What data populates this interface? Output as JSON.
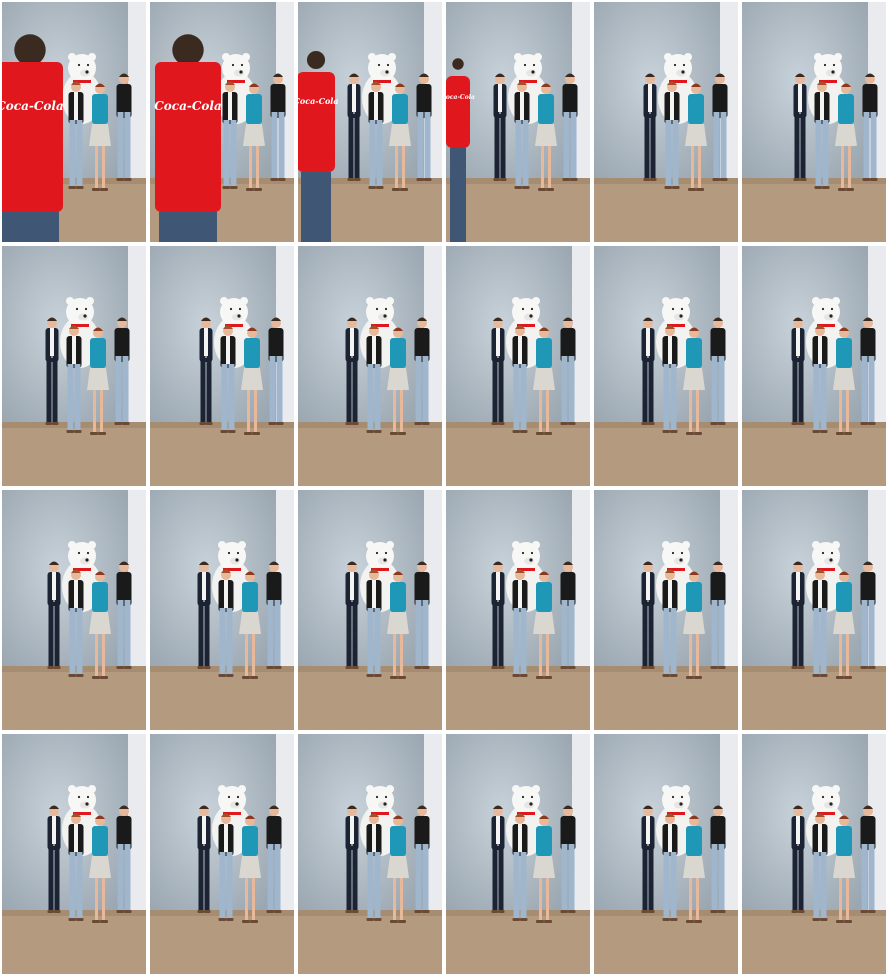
{
  "sheet": {
    "columns": 6,
    "rows": 4
  },
  "colors": {
    "backdrop": "#9aa6b0",
    "backdrop_light": "#c8d2da",
    "wall": "#e9ebee",
    "floor": "#b49a7e",
    "floor_dark": "#9d8468",
    "navy": "#1c2433",
    "black": "#1a1a1a",
    "teal": "#1f97b6",
    "denim": "#9fb6cc",
    "white": "#f4f4f2",
    "skin": "#e7b89a",
    "red": "#e0181e"
  },
  "shirt_text": "Coca-Cola",
  "frames": [
    {
      "pose": "shirt_close",
      "shift": 0
    },
    {
      "pose": "shirt_close",
      "shift": 6
    },
    {
      "pose": "shirt_mid",
      "shift": 4
    },
    {
      "pose": "shirt_leaving",
      "shift": 2
    },
    {
      "pose": "group",
      "shift": 4
    },
    {
      "pose": "group",
      "shift": 6
    },
    {
      "pose": "group",
      "shift": -2
    },
    {
      "pose": "group",
      "shift": 4
    },
    {
      "pose": "group",
      "shift": 2
    },
    {
      "pose": "group",
      "shift": 0
    },
    {
      "pose": "group",
      "shift": 2
    },
    {
      "pose": "group",
      "shift": 4
    },
    {
      "pose": "group",
      "shift": 0
    },
    {
      "pose": "group",
      "shift": 2
    },
    {
      "pose": "group",
      "shift": 2
    },
    {
      "pose": "group",
      "shift": 0
    },
    {
      "pose": "group",
      "shift": 2
    },
    {
      "pose": "group",
      "shift": 4
    },
    {
      "pose": "group",
      "shift": 0
    },
    {
      "pose": "group",
      "shift": 2
    },
    {
      "pose": "group",
      "shift": 2
    },
    {
      "pose": "group",
      "shift": 0
    },
    {
      "pose": "group",
      "shift": 2
    },
    {
      "pose": "group",
      "shift": 4
    }
  ]
}
